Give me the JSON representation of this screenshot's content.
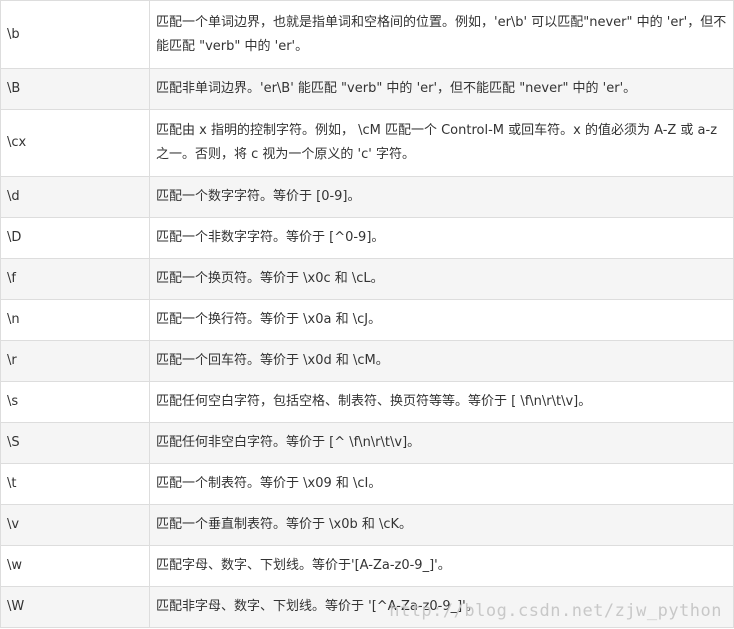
{
  "rows": [
    {
      "symbol": "\\b",
      "description": "匹配一个单词边界，也就是指单词和空格间的位置。例如，'er\\b' 可以匹配\"never\" 中的 'er'，但不能匹配 \"verb\" 中的 'er'。"
    },
    {
      "symbol": "\\B",
      "description": "匹配非单词边界。'er\\B' 能匹配 \"verb\" 中的 'er'，但不能匹配 \"never\" 中的 'er'。"
    },
    {
      "symbol": "\\cx",
      "description": "匹配由 x 指明的控制字符。例如， \\cM 匹配一个 Control-M 或回车符。x 的值必须为 A-Z 或 a-z 之一。否则，将 c 视为一个原义的 'c' 字符。"
    },
    {
      "symbol": "\\d",
      "description": "匹配一个数字字符。等价于 [0-9]。"
    },
    {
      "symbol": "\\D",
      "description": "匹配一个非数字字符。等价于 [^0-9]。"
    },
    {
      "symbol": "\\f",
      "description": "匹配一个换页符。等价于 \\x0c 和 \\cL。"
    },
    {
      "symbol": "\\n",
      "description": "匹配一个换行符。等价于 \\x0a 和 \\cJ。"
    },
    {
      "symbol": "\\r",
      "description": "匹配一个回车符。等价于 \\x0d 和 \\cM。"
    },
    {
      "symbol": "\\s",
      "description": "匹配任何空白字符，包括空格、制表符、换页符等等。等价于 [ \\f\\n\\r\\t\\v]。"
    },
    {
      "symbol": "\\S",
      "description": "匹配任何非空白字符。等价于 [^ \\f\\n\\r\\t\\v]。"
    },
    {
      "symbol": "\\t",
      "description": "匹配一个制表符。等价于 \\x09 和 \\cI。"
    },
    {
      "symbol": "\\v",
      "description": "匹配一个垂直制表符。等价于 \\x0b 和 \\cK。"
    },
    {
      "symbol": "\\w",
      "description": "匹配字母、数字、下划线。等价于'[A-Za-z0-9_]'。"
    },
    {
      "symbol": "\\W",
      "description": "匹配非字母、数字、下划线。等价于 '[^A-Za-z0-9_]'。"
    }
  ],
  "watermark": "http://blog.csdn.net/zjw_python"
}
